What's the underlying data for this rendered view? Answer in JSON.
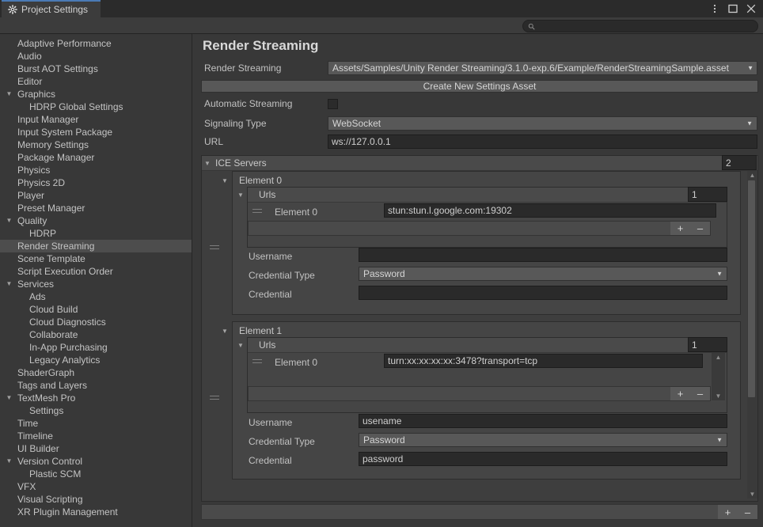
{
  "window": {
    "tab_label": "Project Settings",
    "tab_icon": "gear-icon",
    "menu_icon": "kebab-menu-icon",
    "maximize_icon": "maximize-icon",
    "close_icon": "close-icon"
  },
  "search": {
    "value": "",
    "placeholder": "",
    "icon": "search-icon"
  },
  "sidebar": {
    "items": [
      {
        "label": "Adaptive Performance",
        "level": "root",
        "arrow": "",
        "selected": false
      },
      {
        "label": "Audio",
        "level": "root",
        "arrow": "",
        "selected": false
      },
      {
        "label": "Burst AOT Settings",
        "level": "root",
        "arrow": "",
        "selected": false
      },
      {
        "label": "Editor",
        "level": "root",
        "arrow": "",
        "selected": false
      },
      {
        "label": "Graphics",
        "level": "root",
        "arrow": "▼",
        "selected": false
      },
      {
        "label": "HDRP Global Settings",
        "level": "child",
        "arrow": "",
        "selected": false
      },
      {
        "label": "Input Manager",
        "level": "root",
        "arrow": "",
        "selected": false
      },
      {
        "label": "Input System Package",
        "level": "root",
        "arrow": "",
        "selected": false
      },
      {
        "label": "Memory Settings",
        "level": "root",
        "arrow": "",
        "selected": false
      },
      {
        "label": "Package Manager",
        "level": "root",
        "arrow": "",
        "selected": false
      },
      {
        "label": "Physics",
        "level": "root",
        "arrow": "",
        "selected": false
      },
      {
        "label": "Physics 2D",
        "level": "root",
        "arrow": "",
        "selected": false
      },
      {
        "label": "Player",
        "level": "root",
        "arrow": "",
        "selected": false
      },
      {
        "label": "Preset Manager",
        "level": "root",
        "arrow": "",
        "selected": false
      },
      {
        "label": "Quality",
        "level": "root",
        "arrow": "▼",
        "selected": false
      },
      {
        "label": "HDRP",
        "level": "child",
        "arrow": "",
        "selected": false
      },
      {
        "label": "Render Streaming",
        "level": "root",
        "arrow": "",
        "selected": true
      },
      {
        "label": "Scene Template",
        "level": "root",
        "arrow": "",
        "selected": false
      },
      {
        "label": "Script Execution Order",
        "level": "root",
        "arrow": "",
        "selected": false
      },
      {
        "label": "Services",
        "level": "root",
        "arrow": "▼",
        "selected": false
      },
      {
        "label": "Ads",
        "level": "child",
        "arrow": "",
        "selected": false
      },
      {
        "label": "Cloud Build",
        "level": "child",
        "arrow": "",
        "selected": false
      },
      {
        "label": "Cloud Diagnostics",
        "level": "child",
        "arrow": "",
        "selected": false
      },
      {
        "label": "Collaborate",
        "level": "child",
        "arrow": "",
        "selected": false
      },
      {
        "label": "In-App Purchasing",
        "level": "child",
        "arrow": "",
        "selected": false
      },
      {
        "label": "Legacy Analytics",
        "level": "child",
        "arrow": "",
        "selected": false
      },
      {
        "label": "ShaderGraph",
        "level": "root",
        "arrow": "",
        "selected": false
      },
      {
        "label": "Tags and Layers",
        "level": "root",
        "arrow": "",
        "selected": false
      },
      {
        "label": "TextMesh Pro",
        "level": "root",
        "arrow": "▼",
        "selected": false
      },
      {
        "label": "Settings",
        "level": "child",
        "arrow": "",
        "selected": false
      },
      {
        "label": "Time",
        "level": "root",
        "arrow": "",
        "selected": false
      },
      {
        "label": "Timeline",
        "level": "root",
        "arrow": "",
        "selected": false
      },
      {
        "label": "UI Builder",
        "level": "root",
        "arrow": "",
        "selected": false
      },
      {
        "label": "Version Control",
        "level": "root",
        "arrow": "▼",
        "selected": false
      },
      {
        "label": "Plastic SCM",
        "level": "child",
        "arrow": "",
        "selected": false
      },
      {
        "label": "VFX",
        "level": "root",
        "arrow": "",
        "selected": false
      },
      {
        "label": "Visual Scripting",
        "level": "root",
        "arrow": "",
        "selected": false
      },
      {
        "label": "XR Plugin Management",
        "level": "root",
        "arrow": "",
        "selected": false
      }
    ]
  },
  "main": {
    "page_title": "Render Streaming",
    "render_streaming": {
      "label": "Render Streaming",
      "value": "Assets/Samples/Unity Render Streaming/3.1.0-exp.6/Example/RenderStreamingSample.asset"
    },
    "create_asset_button": "Create New Settings Asset",
    "automatic_streaming": {
      "label": "Automatic Streaming",
      "checked": false
    },
    "signaling_type": {
      "label": "Signaling Type",
      "value": "WebSocket"
    },
    "url": {
      "label": "URL",
      "value": "ws://127.0.0.1"
    },
    "ice_servers": {
      "title": "ICE Servers",
      "size": "2",
      "elements": [
        {
          "title": "Element 0",
          "urls": {
            "title": "Urls",
            "size": "1",
            "items": [
              {
                "label": "Element 0",
                "value": "stun:stun.l.google.com:19302"
              }
            ],
            "add_label": "+",
            "remove_label": "–"
          },
          "username": {
            "label": "Username",
            "value": ""
          },
          "credential_type": {
            "label": "Credential Type",
            "value": "Password"
          },
          "credential": {
            "label": "Credential",
            "value": ""
          }
        },
        {
          "title": "Element 1",
          "urls": {
            "title": "Urls",
            "size": "1",
            "items": [
              {
                "label": "Element 0",
                "value": "turn:xx:xx:xx:xx:3478?transport=tcp"
              }
            ],
            "add_label": "+",
            "remove_label": "–"
          },
          "username": {
            "label": "Username",
            "value": "usename"
          },
          "credential_type": {
            "label": "Credential Type",
            "value": "Password"
          },
          "credential": {
            "label": "Credential",
            "value": "password"
          }
        }
      ],
      "add_label": "+",
      "remove_label": "–"
    }
  },
  "colors": {
    "window_bg": "#383838",
    "panel_bg": "#3c3c3c",
    "tab_accent": "#4a7ab5",
    "selection": "#4d4d4d",
    "field_bg": "#585858",
    "input_bg": "#2a2a2a",
    "text": "#c4c4c4"
  }
}
